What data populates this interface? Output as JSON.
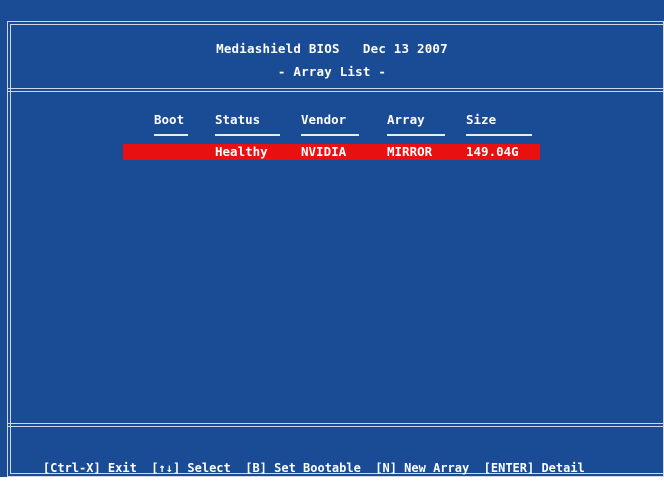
{
  "header": {
    "title": "Mediashield BIOS   Dec 13 2007",
    "subtitle": "- Array List -"
  },
  "table": {
    "columns": [
      "Boot",
      "Status",
      "Vendor",
      "Array",
      "Size"
    ],
    "rows": [
      {
        "boot": "",
        "status": "Healthy",
        "vendor": "NVIDIA",
        "array": "MIRROR",
        "size": "149.04G"
      }
    ]
  },
  "footer": {
    "exit": "[Ctrl-X] Exit",
    "select": "[↑↓] Select",
    "bootable": "[B] Set Bootable",
    "new_array": "[N] New Array",
    "detail": "[ENTER] Detail"
  },
  "colors": {
    "background": "#1a4c96",
    "highlight": "#e81010",
    "text": "#ffffff"
  }
}
